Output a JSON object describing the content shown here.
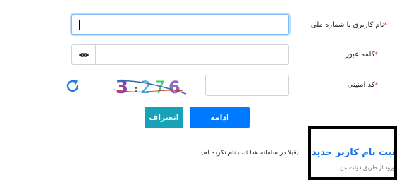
{
  "form": {
    "username": {
      "label": "نام کاربری یا شماره ملی",
      "required_mark": "*",
      "value": "",
      "placeholder": ""
    },
    "password": {
      "label": "کلمه عبور",
      "required_mark": "*",
      "value": "",
      "placeholder": ""
    },
    "captcha": {
      "label": "کد امنیتی",
      "required_mark": "*",
      "value": "",
      "placeholder": "",
      "image_text": "3276"
    },
    "continue_label": "ادامه",
    "cancel_label": "انصراف"
  },
  "register": {
    "link_text": "ثبت نام کاربر جدید",
    "sub_text": "ورود از طریق دولت من",
    "note": "(قبلا در سامانه هدا ثبت نام نکرده ام)"
  },
  "colors": {
    "primary": "#007bff",
    "info": "#17a2b8",
    "link": "#1a73e8",
    "required": "#dc3545"
  },
  "icons": {
    "show_password": "eye-icon",
    "refresh_captcha": "refresh-icon"
  }
}
